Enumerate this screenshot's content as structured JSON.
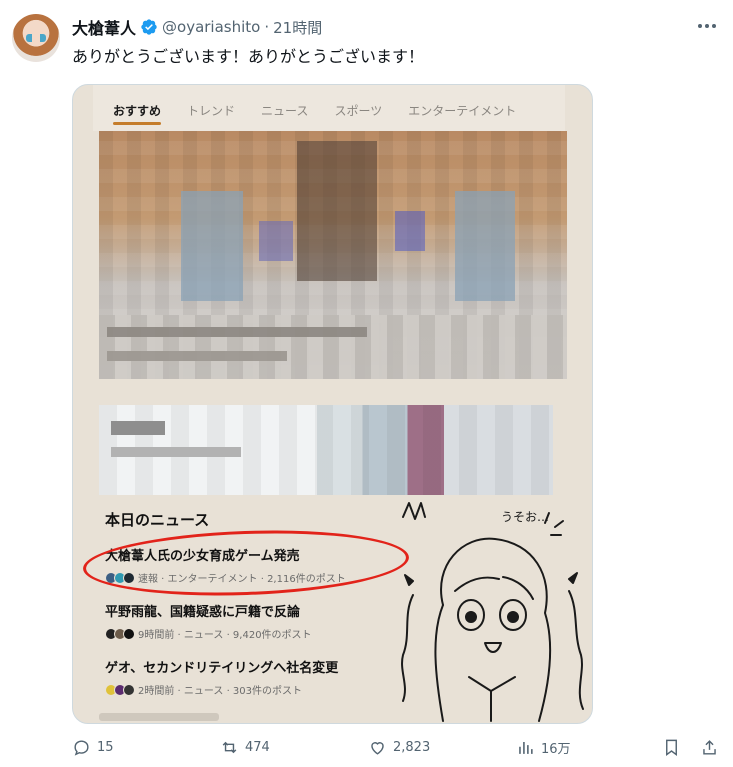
{
  "tweet": {
    "author_name": "大槍葦人",
    "handle": "@oyariashito",
    "separator": "·",
    "time": "21時間",
    "text": "ありがとうございます！ありがとうございます！"
  },
  "screenshot": {
    "tabs": [
      {
        "label": "おすすめ",
        "active": true
      },
      {
        "label": "トレンド",
        "active": false
      },
      {
        "label": "ニュース",
        "active": false
      },
      {
        "label": "スポーツ",
        "active": false
      },
      {
        "label": "エンターテイメント",
        "active": false
      }
    ],
    "news_section_title": "本日のニュース",
    "news": [
      {
        "headline": "大槍葦人氏の少女育成ゲーム発売",
        "meta": "速報 · エンターテイメント · 2,116件のポスト"
      },
      {
        "headline": "平野雨龍、国籍疑惑に戸籍で反論",
        "meta": "9時間前 · ニュース · 9,420件のポスト"
      },
      {
        "headline": "ゲオ、セカンドリテイリングへ社名変更",
        "meta": "2時間前 · ニュース · 303件のポスト"
      }
    ],
    "drawing_text": "うそお…"
  },
  "actions": {
    "replies": "15",
    "reposts": "474",
    "likes": "2,823",
    "views": "16万"
  },
  "colors": {
    "accent_red": "#e2231a",
    "verified_blue": "#1d9bf0",
    "tab_underline": "#c57d2b"
  },
  "icons": [
    "verified-badge-icon",
    "more-icon",
    "reply-icon",
    "repost-icon",
    "like-icon",
    "views-icon",
    "bookmark-icon",
    "share-icon"
  ]
}
